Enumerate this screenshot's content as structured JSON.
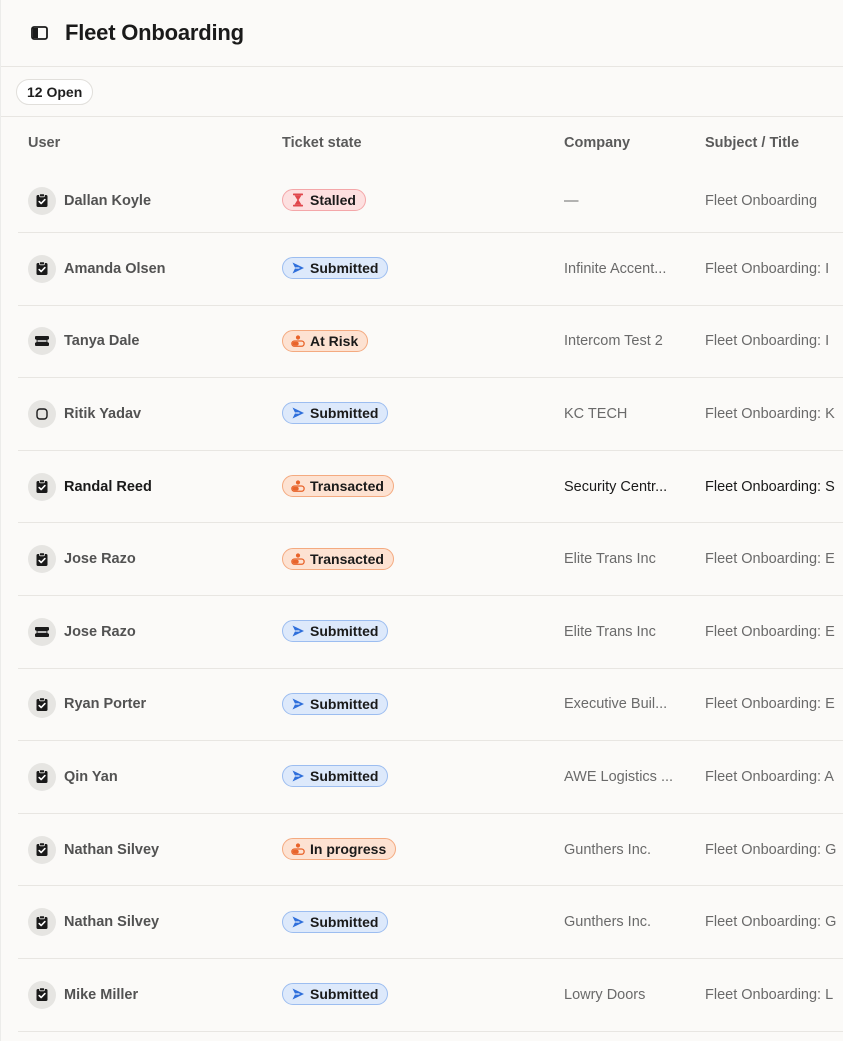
{
  "header": {
    "title": "Fleet Onboarding",
    "toggle_icon": "sidebar-panel-icon"
  },
  "filter": {
    "count_label": "12 Open"
  },
  "table": {
    "columns": {
      "user": "User",
      "state": "Ticket state",
      "company": "Company",
      "subject": "Subject / Title"
    },
    "rows": [
      {
        "user": "Dallan Koyle",
        "avatar_icon": "clipboard-check-icon",
        "state": "Stalled",
        "state_kind": "stalled",
        "state_icon": "hourglass-icon",
        "company": "—",
        "subject": "Fleet Onboarding",
        "unread": false
      },
      {
        "user": "Amanda Olsen",
        "avatar_icon": "clipboard-check-icon",
        "state": "Submitted",
        "state_kind": "submitted",
        "state_icon": "send-icon",
        "company": "Infinite Accent...",
        "subject": "Fleet Onboarding: I",
        "unread": false
      },
      {
        "user": "Tanya Dale",
        "avatar_icon": "ticket-icon",
        "state": "At Risk",
        "state_kind": "orange",
        "state_icon": "progress-icon",
        "company": "Intercom Test 2",
        "subject": "Fleet Onboarding: I",
        "unread": false
      },
      {
        "user": "Ritik Yadav",
        "avatar_icon": "square-outline-icon",
        "state": "Submitted",
        "state_kind": "submitted",
        "state_icon": "send-icon",
        "company": "KC TECH",
        "subject": "Fleet Onboarding: K",
        "unread": false
      },
      {
        "user": "Randal Reed",
        "avatar_icon": "clipboard-check-icon",
        "state": "Transacted",
        "state_kind": "orange",
        "state_icon": "progress-icon",
        "company": "Security Centr...",
        "subject": "Fleet Onboarding: S",
        "unread": true
      },
      {
        "user": "Jose Razo",
        "avatar_icon": "clipboard-check-icon",
        "state": "Transacted",
        "state_kind": "orange",
        "state_icon": "progress-icon",
        "company": "Elite Trans Inc",
        "subject": "Fleet Onboarding: E",
        "unread": false
      },
      {
        "user": "Jose Razo",
        "avatar_icon": "ticket-icon",
        "state": "Submitted",
        "state_kind": "submitted",
        "state_icon": "send-icon",
        "company": "Elite Trans Inc",
        "subject": "Fleet Onboarding: E",
        "unread": false
      },
      {
        "user": "Ryan Porter",
        "avatar_icon": "clipboard-check-icon",
        "state": "Submitted",
        "state_kind": "submitted",
        "state_icon": "send-icon",
        "company": "Executive Buil...",
        "subject": "Fleet Onboarding: E",
        "unread": false
      },
      {
        "user": "Qin Yan",
        "avatar_icon": "clipboard-check-icon",
        "state": "Submitted",
        "state_kind": "submitted",
        "state_icon": "send-icon",
        "company": "AWE Logistics ...",
        "subject": "Fleet Onboarding: A",
        "unread": false
      },
      {
        "user": "Nathan Silvey",
        "avatar_icon": "clipboard-check-icon",
        "state": "In progress",
        "state_kind": "orange",
        "state_icon": "progress-icon",
        "company": "Gunthers Inc.",
        "subject": "Fleet Onboarding: G",
        "unread": false
      },
      {
        "user": "Nathan Silvey",
        "avatar_icon": "clipboard-check-icon",
        "state": "Submitted",
        "state_kind": "submitted",
        "state_icon": "send-icon",
        "company": "Gunthers Inc.",
        "subject": "Fleet Onboarding: G",
        "unread": false
      },
      {
        "user": "Mike Miller",
        "avatar_icon": "clipboard-check-icon",
        "state": "Submitted",
        "state_kind": "submitted",
        "state_icon": "send-icon",
        "company": "Lowry Doors",
        "subject": "Fleet Onboarding: L",
        "unread": false
      }
    ]
  },
  "colors": {
    "stalled_icon": "#e0474c",
    "submitted_icon": "#2f6fdb",
    "orange_icon": "#e8632a"
  }
}
